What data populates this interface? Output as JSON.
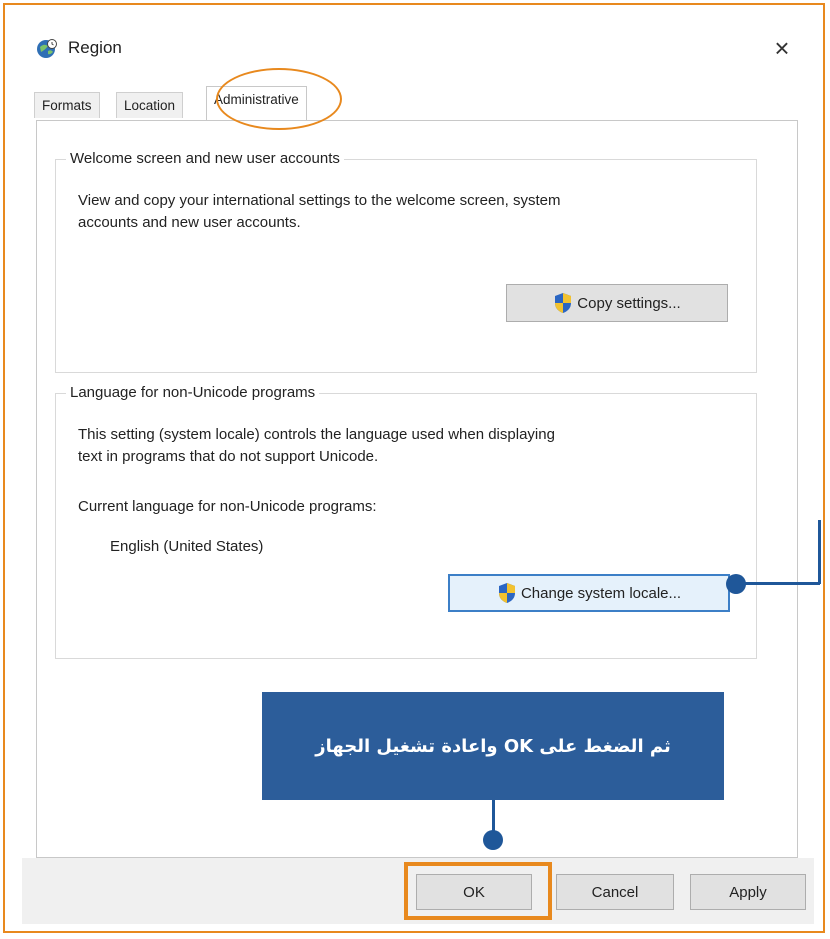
{
  "window": {
    "title": "Region",
    "close_glyph": "×"
  },
  "tabs": [
    {
      "label": "Formats"
    },
    {
      "label": "Location"
    },
    {
      "label": "Administrative"
    }
  ],
  "welcome_group": {
    "title": "Welcome screen and new user accounts",
    "description_line1": "View and copy your international settings to the welcome screen, system",
    "description_line2": "accounts and new user accounts.",
    "button_label": "Copy settings..."
  },
  "language_group": {
    "title": "Language for non-Unicode programs",
    "description_line1": "This setting (system locale) controls the language used when displaying",
    "description_line2": "text in programs that do not support Unicode.",
    "current_label": "Current language for non-Unicode programs:",
    "current_value": "English (United States)",
    "button_label": "Change system locale..."
  },
  "annotation": {
    "text": "ثم الضغط على OK واعادة تشغيل الجهاز",
    "color": "#2c5d9a",
    "highlight_color": "#e8891e"
  },
  "footer": {
    "ok_label": "OK",
    "cancel_label": "Cancel",
    "apply_label": "Apply"
  },
  "icons": {
    "app": "globe-clock-icon",
    "shield": "uac-shield-icon",
    "close": "close-icon"
  }
}
